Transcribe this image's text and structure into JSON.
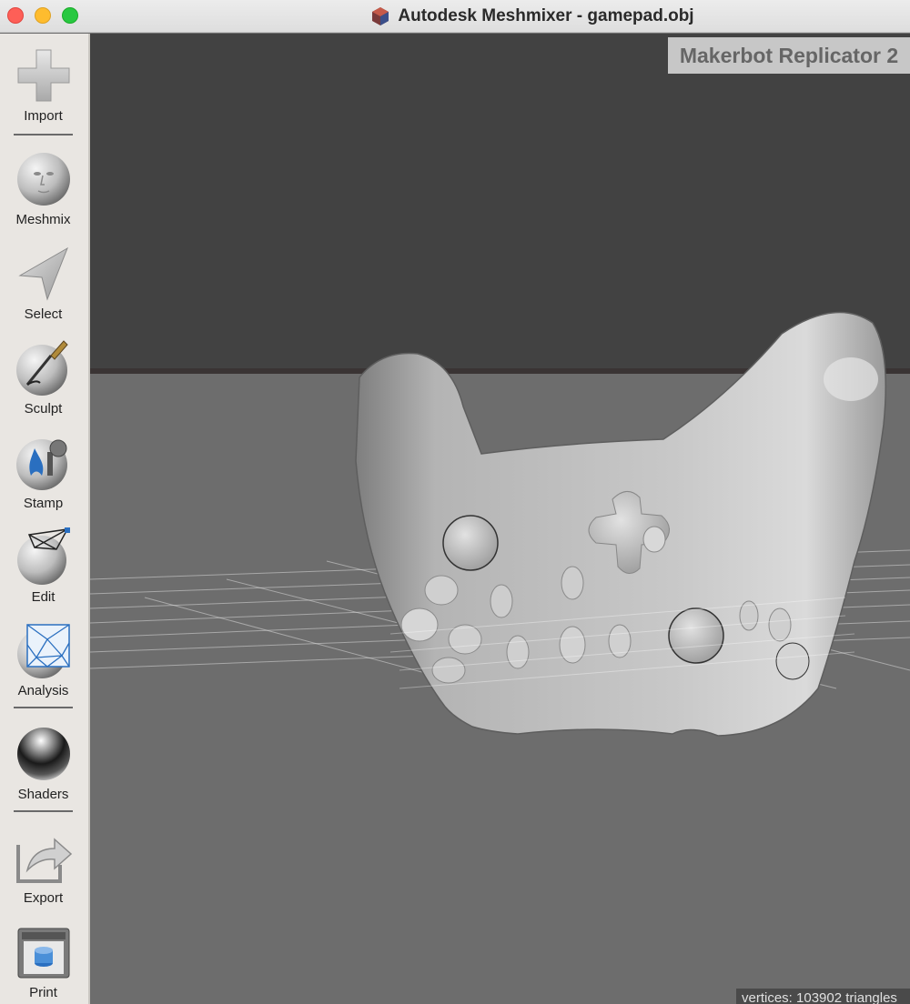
{
  "window": {
    "title": "Autodesk Meshmixer - gamepad.obj"
  },
  "sidebar": {
    "tools": [
      {
        "label": "Import",
        "icon": "plus-icon"
      },
      {
        "label": "Meshmix",
        "icon": "face-sphere-icon"
      },
      {
        "label": "Select",
        "icon": "arrow-pointer-icon"
      },
      {
        "label": "Sculpt",
        "icon": "brush-sphere-icon"
      },
      {
        "label": "Stamp",
        "icon": "stamp-sphere-icon"
      },
      {
        "label": "Edit",
        "icon": "wireframe-sphere-icon"
      },
      {
        "label": "Analysis",
        "icon": "mesh-analysis-icon"
      },
      {
        "label": "Shaders",
        "icon": "chrome-sphere-icon"
      },
      {
        "label": "Export",
        "icon": "export-arrow-icon"
      },
      {
        "label": "Print",
        "icon": "printer-icon"
      }
    ]
  },
  "viewport": {
    "printer": "Makerbot Replicator 2",
    "stats": "vertices: 103902 triangles"
  },
  "colors": {
    "background_top": "#424242",
    "floor": "#6d6d6d",
    "mesh": "#b8b8b8",
    "sidebar": "#e9e6e2"
  }
}
